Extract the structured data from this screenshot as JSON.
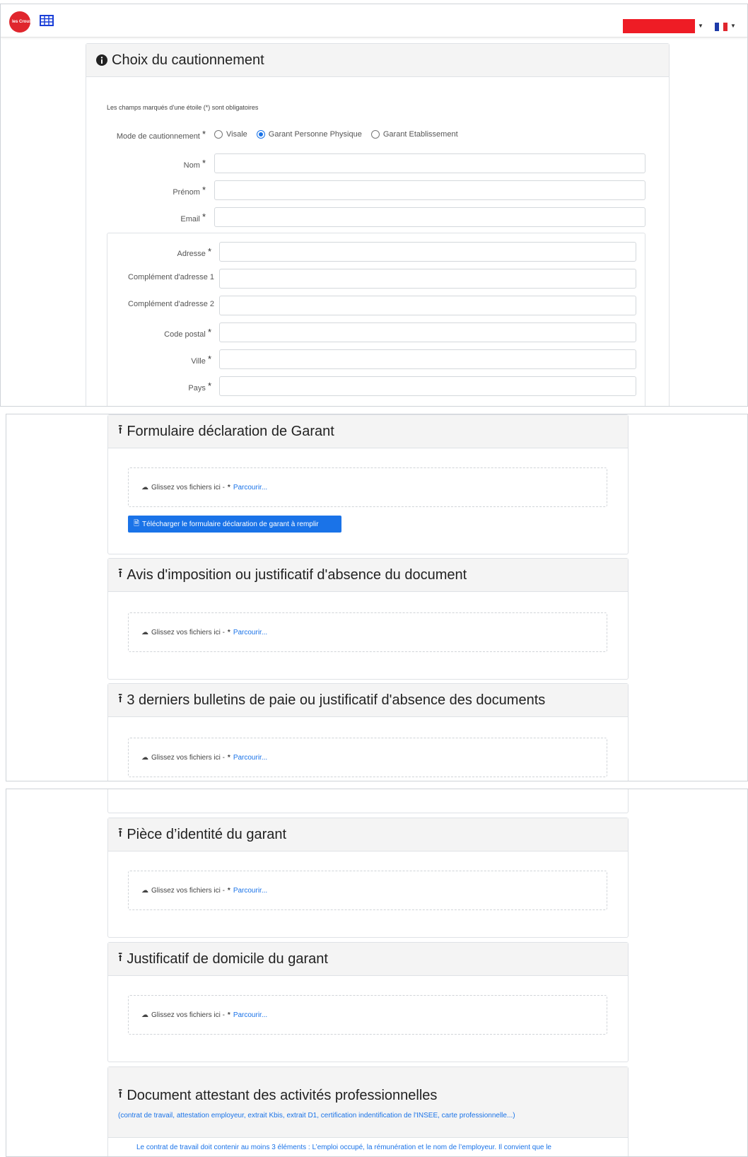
{
  "navbar": {
    "logo_text": "les Crous",
    "brand_color": "#e0262d",
    "user_block_color": "#ee1c25",
    "icons": [
      "grid-icon",
      "flag-fr-icon"
    ]
  },
  "section1": {
    "title": "Choix du cautionnement",
    "required_hint": "Les champs marqués d'une étoile (*) sont obligatoires",
    "mode_label": "Mode de cautionnement",
    "options": [
      "Visale",
      "Garant Personne Physique",
      "Garant Etablissement"
    ],
    "selected_option": "Garant Personne Physique",
    "fields": {
      "nom": "Nom",
      "prenom": "Prénom",
      "email": "Email"
    },
    "address": {
      "adresse": "Adresse",
      "complement1": "Complément d'adresse 1",
      "complement2": "Complément d'adresse 2",
      "code_postal": "Code postal",
      "ville": "Ville",
      "pays": "Pays"
    },
    "star": "*"
  },
  "uploads": {
    "dropzone_text": "Glissez vos fichiers ici - ",
    "star": "*",
    "browse_label": "Parcourir...",
    "declaration_title": "Formulaire déclaration de Garant",
    "declaration_button": "Télécharger le formulaire déclaration de garant à remplir",
    "avis_title": "Avis d'imposition ou justificatif d'absence du document",
    "bulletins_title": "3 derniers bulletins de paie ou justificatif d'absence des documents",
    "identite_title": "Pièce d’identité du garant",
    "domicile_title": "Justificatif de domicile du garant",
    "activites_title": "Document attestant des activités professionnelles",
    "activites_subtitle": "(contrat de travail, attestation employeur, extrait Kbis, extrait D1, certification indentification de l'INSEE, carte professionnelle...)",
    "activites_body": "Le contrat de travail doit contenir au moins 3 éléments : L’emploi occupé, la rémunération et le nom de l’employeur. Il convient que le"
  },
  "colors": {
    "accent": "#1a73e8",
    "header_bg": "#f4f4f4"
  }
}
